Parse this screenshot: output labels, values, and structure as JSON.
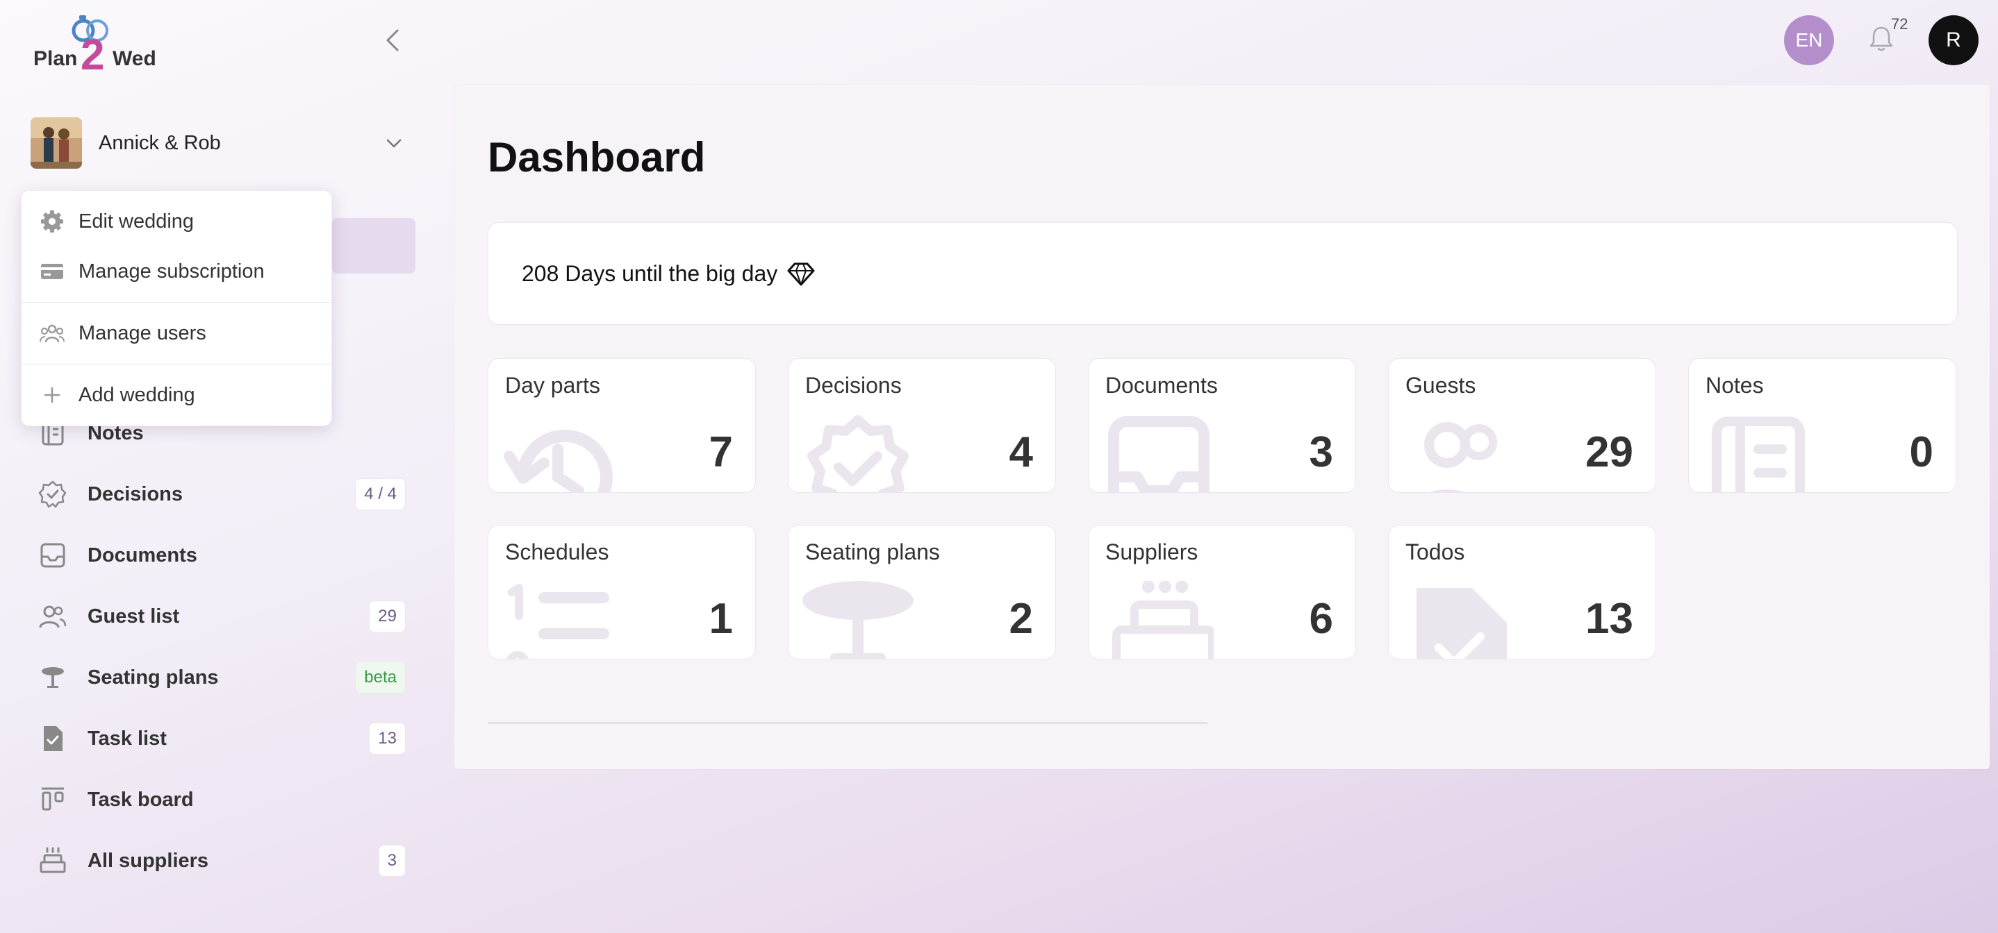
{
  "brand": {
    "name": "Plan2Wed",
    "plan": "Plan",
    "two": "2",
    "wed": "Wed"
  },
  "wedding": {
    "name": "Annick & Rob"
  },
  "dropdown": {
    "items": [
      {
        "label": "Edit wedding",
        "icon": "gear-icon"
      },
      {
        "label": "Manage subscription",
        "icon": "credit-card-icon"
      },
      {
        "label": "Manage users",
        "icon": "users-icon"
      },
      {
        "label": "Add wedding",
        "icon": "plus-icon"
      }
    ]
  },
  "nav": {
    "items": [
      {
        "label": "Notes",
        "icon": "notes-icon",
        "badge": ""
      },
      {
        "label": "Decisions",
        "icon": "check-badge-icon",
        "badge": "4 / 4"
      },
      {
        "label": "Documents",
        "icon": "inbox-icon",
        "badge": ""
      },
      {
        "label": "Guest list",
        "icon": "users-icon",
        "badge": "29"
      },
      {
        "label": "Seating plans",
        "icon": "table-icon",
        "badge": "beta"
      },
      {
        "label": "Task list",
        "icon": "task-icon",
        "badge": "13"
      },
      {
        "label": "Task board",
        "icon": "board-icon",
        "badge": ""
      },
      {
        "label": "All suppliers",
        "icon": "cake-icon",
        "badge": "3"
      }
    ]
  },
  "topbar": {
    "lang": "EN",
    "notifications": "72",
    "user_initial": "R"
  },
  "main": {
    "title": "Dashboard",
    "countdown": "208 Days until the big day",
    "cards": [
      {
        "title": "Day parts",
        "value": "7",
        "icon": "history-icon"
      },
      {
        "title": "Decisions",
        "value": "4",
        "icon": "check-badge-icon"
      },
      {
        "title": "Documents",
        "value": "3",
        "icon": "inbox-icon"
      },
      {
        "title": "Guests",
        "value": "29",
        "icon": "users-icon"
      },
      {
        "title": "Notes",
        "value": "0",
        "icon": "notes-icon"
      },
      {
        "title": "Schedules",
        "value": "1",
        "icon": "list-ordered-icon"
      },
      {
        "title": "Seating plans",
        "value": "2",
        "icon": "table-icon"
      },
      {
        "title": "Suppliers",
        "value": "6",
        "icon": "cake-icon"
      },
      {
        "title": "Todos",
        "value": "13",
        "icon": "task-icon"
      }
    ]
  },
  "colors": {
    "accent": "#b48ecb",
    "brand_blue": "#4a84c4",
    "brand_pink": "#c44a9a"
  }
}
